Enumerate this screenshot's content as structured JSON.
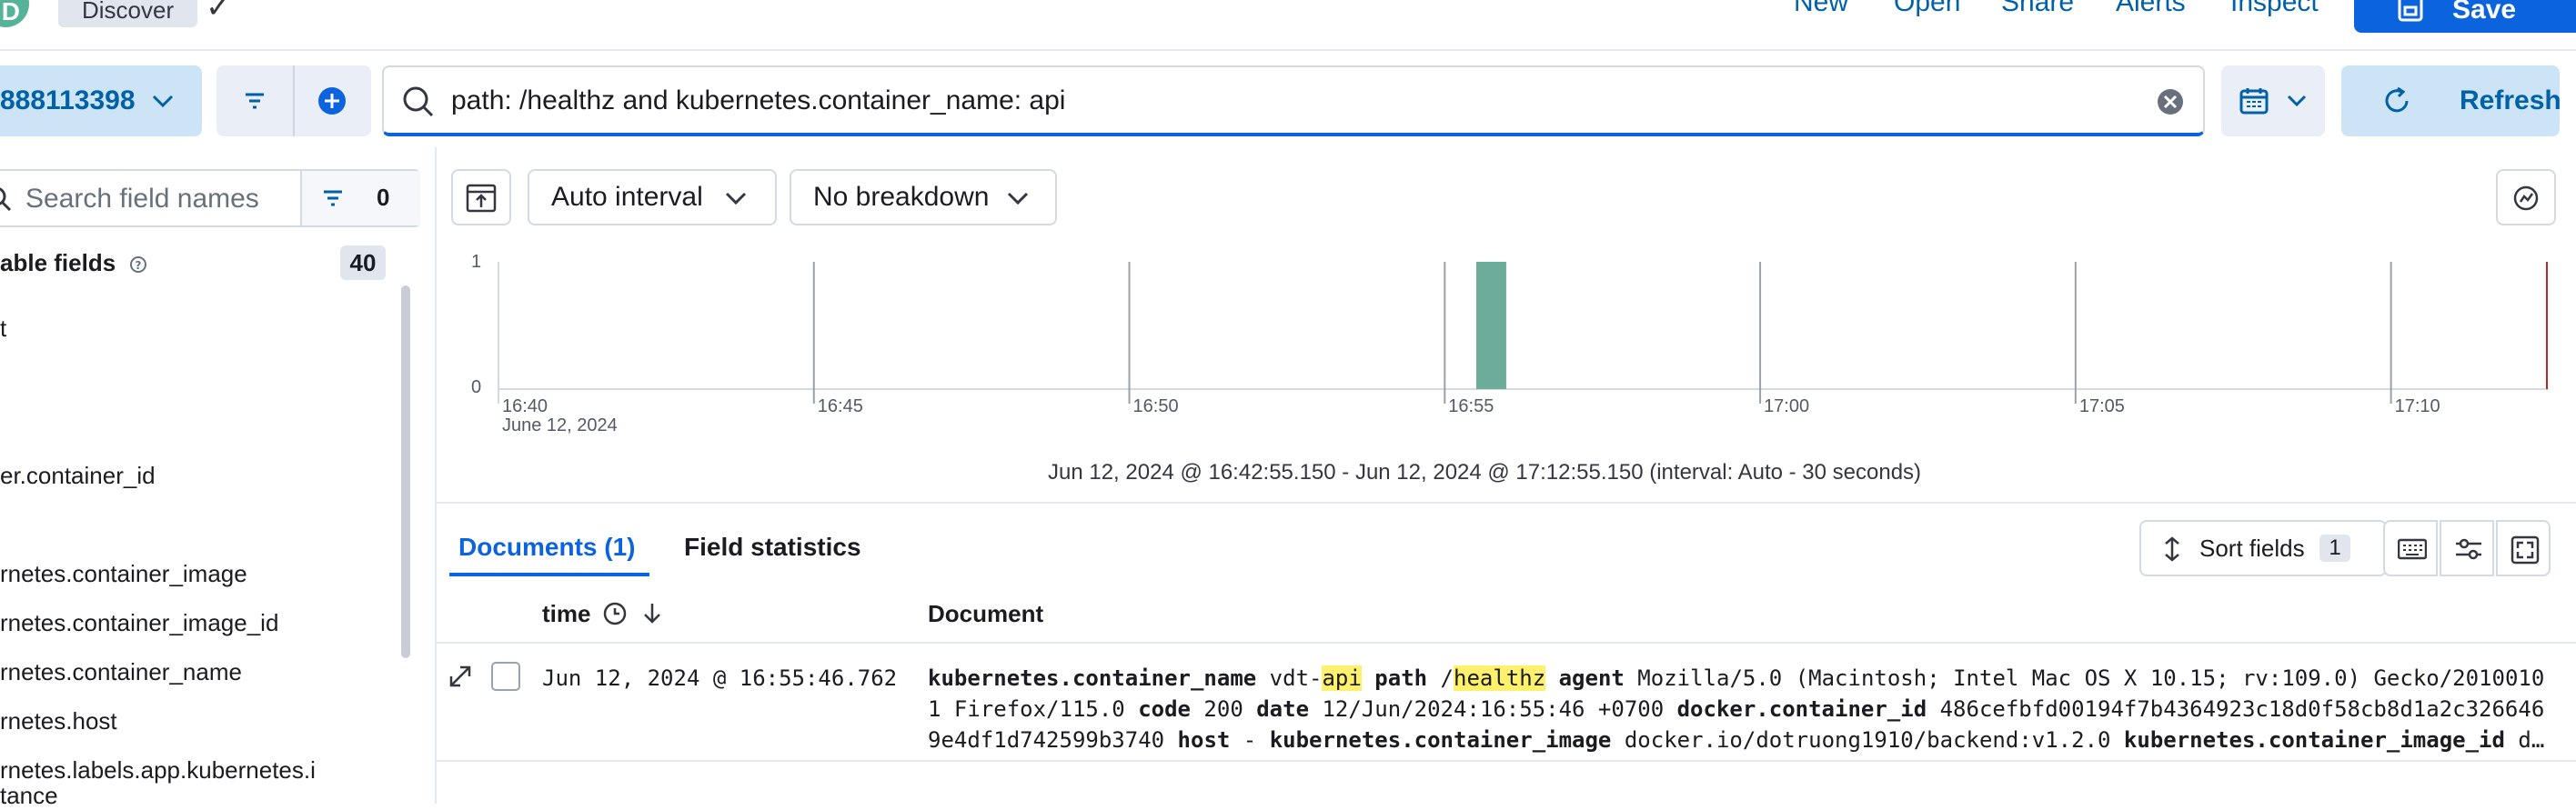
{
  "topbar": {
    "avatar_initial": "D",
    "discover_badge": "Discover",
    "links": [
      "New",
      "Open",
      "Share",
      "Alerts",
      "Inspect"
    ],
    "save_label": "Save"
  },
  "query_bar": {
    "data_view": "888113398",
    "query": "path: /healthz and kubernetes.container_name: api",
    "refresh_label": "Refresh"
  },
  "sidebar": {
    "search_placeholder": "Search field names",
    "filter_count": "0",
    "section_title": "able fields",
    "section_count": "40",
    "fields": [
      "t",
      "er.container_id",
      "rnetes.container_image",
      "rnetes.container_image_id",
      "rnetes.container_name",
      "rnetes.host",
      "rnetes.labels.app.kubernetes.i",
      "tance"
    ]
  },
  "chart_toolbar": {
    "interval": "Auto interval",
    "breakdown": "No breakdown"
  },
  "chart_data": {
    "type": "bar",
    "y_ticks": [
      "1",
      "0"
    ],
    "ylim": [
      0,
      1
    ],
    "x_ticks": [
      "16:40",
      "16:45",
      "16:50",
      "16:55",
      "17:00",
      "17:05",
      "17:10"
    ],
    "x_date": "June 12, 2024",
    "bars": [
      {
        "x": "16:55:30",
        "value": 1
      }
    ],
    "bar_color": "#6dab9a",
    "range_text": "Jun 12, 2024 @ 16:42:55.150 - Jun 12, 2024 @ 17:12:55.150 (interval: Auto - 30 seconds)"
  },
  "documents": {
    "tab_documents": "Documents (1)",
    "tab_field_stats": "Field statistics",
    "sort_label": "Sort fields",
    "sort_count": "1",
    "col_time": "time",
    "col_document": "Document",
    "row": {
      "time": "Jun 12, 2024 @ 16:55:46.762",
      "line1": [
        {
          "t": "kubernetes.container_name",
          "s": "k"
        },
        {
          "t": " vdt-",
          "s": ""
        },
        {
          "t": "api",
          "s": "hl"
        },
        {
          "t": " ",
          "s": ""
        },
        {
          "t": "path",
          "s": "k"
        },
        {
          "t": " /",
          "s": ""
        },
        {
          "t": "healthz",
          "s": "hl"
        },
        {
          "t": " ",
          "s": ""
        },
        {
          "t": "agent",
          "s": "k"
        },
        {
          "t": " Mozilla/5.0 (Macintosh; Intel Mac OS X 10.15; rv:109.0) Gecko/2010010",
          "s": ""
        }
      ],
      "line2": [
        {
          "t": "1 Firefox/115.0 ",
          "s": ""
        },
        {
          "t": "code",
          "s": "k"
        },
        {
          "t": " 200 ",
          "s": ""
        },
        {
          "t": "date",
          "s": "k"
        },
        {
          "t": " 12/Jun/2024:16:55:46 +0700 ",
          "s": ""
        },
        {
          "t": "docker.container_id",
          "s": "k"
        },
        {
          "t": " 486cefbfd00194f7b4364923c18d0f58cb8d1a2c326646",
          "s": ""
        }
      ],
      "line3": [
        {
          "t": "9e4df1d742599b3740 ",
          "s": ""
        },
        {
          "t": "host",
          "s": "k"
        },
        {
          "t": " - ",
          "s": ""
        },
        {
          "t": "kubernetes.container_image",
          "s": "k"
        },
        {
          "t": " docker.io/dotruong1910/backend:v1.2.0 ",
          "s": ""
        },
        {
          "t": "kubernetes.container_image_id",
          "s": "k"
        },
        {
          "t": " d…",
          "s": ""
        }
      ]
    }
  }
}
